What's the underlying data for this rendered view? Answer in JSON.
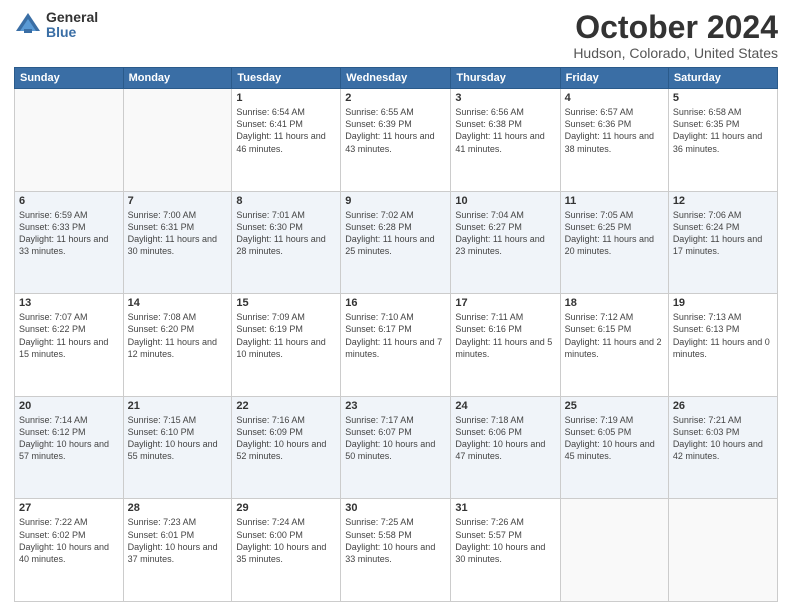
{
  "logo": {
    "general": "General",
    "blue": "Blue"
  },
  "title": "October 2024",
  "subtitle": "Hudson, Colorado, United States",
  "headers": [
    "Sunday",
    "Monday",
    "Tuesday",
    "Wednesday",
    "Thursday",
    "Friday",
    "Saturday"
  ],
  "rows": [
    [
      {
        "day": "",
        "info": ""
      },
      {
        "day": "",
        "info": ""
      },
      {
        "day": "1",
        "info": "Sunrise: 6:54 AM\nSunset: 6:41 PM\nDaylight: 11 hours\nand 46 minutes."
      },
      {
        "day": "2",
        "info": "Sunrise: 6:55 AM\nSunset: 6:39 PM\nDaylight: 11 hours\nand 43 minutes."
      },
      {
        "day": "3",
        "info": "Sunrise: 6:56 AM\nSunset: 6:38 PM\nDaylight: 11 hours\nand 41 minutes."
      },
      {
        "day": "4",
        "info": "Sunrise: 6:57 AM\nSunset: 6:36 PM\nDaylight: 11 hours\nand 38 minutes."
      },
      {
        "day": "5",
        "info": "Sunrise: 6:58 AM\nSunset: 6:35 PM\nDaylight: 11 hours\nand 36 minutes."
      }
    ],
    [
      {
        "day": "6",
        "info": "Sunrise: 6:59 AM\nSunset: 6:33 PM\nDaylight: 11 hours\nand 33 minutes."
      },
      {
        "day": "7",
        "info": "Sunrise: 7:00 AM\nSunset: 6:31 PM\nDaylight: 11 hours\nand 30 minutes."
      },
      {
        "day": "8",
        "info": "Sunrise: 7:01 AM\nSunset: 6:30 PM\nDaylight: 11 hours\nand 28 minutes."
      },
      {
        "day": "9",
        "info": "Sunrise: 7:02 AM\nSunset: 6:28 PM\nDaylight: 11 hours\nand 25 minutes."
      },
      {
        "day": "10",
        "info": "Sunrise: 7:04 AM\nSunset: 6:27 PM\nDaylight: 11 hours\nand 23 minutes."
      },
      {
        "day": "11",
        "info": "Sunrise: 7:05 AM\nSunset: 6:25 PM\nDaylight: 11 hours\nand 20 minutes."
      },
      {
        "day": "12",
        "info": "Sunrise: 7:06 AM\nSunset: 6:24 PM\nDaylight: 11 hours\nand 17 minutes."
      }
    ],
    [
      {
        "day": "13",
        "info": "Sunrise: 7:07 AM\nSunset: 6:22 PM\nDaylight: 11 hours\nand 15 minutes."
      },
      {
        "day": "14",
        "info": "Sunrise: 7:08 AM\nSunset: 6:20 PM\nDaylight: 11 hours\nand 12 minutes."
      },
      {
        "day": "15",
        "info": "Sunrise: 7:09 AM\nSunset: 6:19 PM\nDaylight: 11 hours\nand 10 minutes."
      },
      {
        "day": "16",
        "info": "Sunrise: 7:10 AM\nSunset: 6:17 PM\nDaylight: 11 hours\nand 7 minutes."
      },
      {
        "day": "17",
        "info": "Sunrise: 7:11 AM\nSunset: 6:16 PM\nDaylight: 11 hours\nand 5 minutes."
      },
      {
        "day": "18",
        "info": "Sunrise: 7:12 AM\nSunset: 6:15 PM\nDaylight: 11 hours\nand 2 minutes."
      },
      {
        "day": "19",
        "info": "Sunrise: 7:13 AM\nSunset: 6:13 PM\nDaylight: 11 hours\nand 0 minutes."
      }
    ],
    [
      {
        "day": "20",
        "info": "Sunrise: 7:14 AM\nSunset: 6:12 PM\nDaylight: 10 hours\nand 57 minutes."
      },
      {
        "day": "21",
        "info": "Sunrise: 7:15 AM\nSunset: 6:10 PM\nDaylight: 10 hours\nand 55 minutes."
      },
      {
        "day": "22",
        "info": "Sunrise: 7:16 AM\nSunset: 6:09 PM\nDaylight: 10 hours\nand 52 minutes."
      },
      {
        "day": "23",
        "info": "Sunrise: 7:17 AM\nSunset: 6:07 PM\nDaylight: 10 hours\nand 50 minutes."
      },
      {
        "day": "24",
        "info": "Sunrise: 7:18 AM\nSunset: 6:06 PM\nDaylight: 10 hours\nand 47 minutes."
      },
      {
        "day": "25",
        "info": "Sunrise: 7:19 AM\nSunset: 6:05 PM\nDaylight: 10 hours\nand 45 minutes."
      },
      {
        "day": "26",
        "info": "Sunrise: 7:21 AM\nSunset: 6:03 PM\nDaylight: 10 hours\nand 42 minutes."
      }
    ],
    [
      {
        "day": "27",
        "info": "Sunrise: 7:22 AM\nSunset: 6:02 PM\nDaylight: 10 hours\nand 40 minutes."
      },
      {
        "day": "28",
        "info": "Sunrise: 7:23 AM\nSunset: 6:01 PM\nDaylight: 10 hours\nand 37 minutes."
      },
      {
        "day": "29",
        "info": "Sunrise: 7:24 AM\nSunset: 6:00 PM\nDaylight: 10 hours\nand 35 minutes."
      },
      {
        "day": "30",
        "info": "Sunrise: 7:25 AM\nSunset: 5:58 PM\nDaylight: 10 hours\nand 33 minutes."
      },
      {
        "day": "31",
        "info": "Sunrise: 7:26 AM\nSunset: 5:57 PM\nDaylight: 10 hours\nand 30 minutes."
      },
      {
        "day": "",
        "info": ""
      },
      {
        "day": "",
        "info": ""
      }
    ]
  ]
}
